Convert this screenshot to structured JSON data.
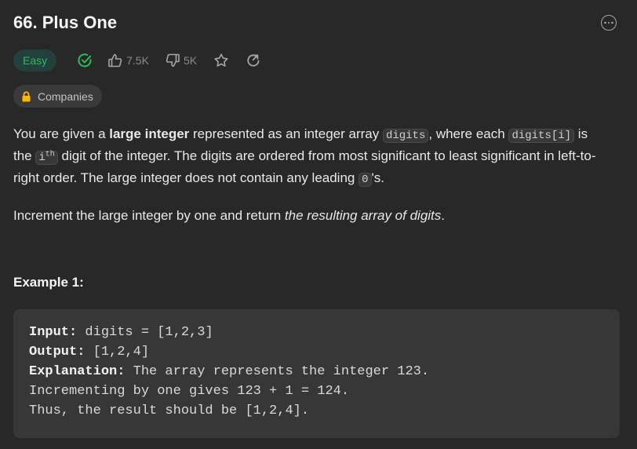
{
  "problem": {
    "title": "66. Plus One",
    "difficulty": "Easy",
    "likes": "7.5K",
    "dislikes": "5K",
    "companies_label": "Companies",
    "colors": {
      "easy": "#2cbb5d",
      "lock": "#ffb800",
      "background": "#282828"
    }
  },
  "icons": {
    "more": "more-horizontal-circle-icon",
    "solved": "check-circle-icon",
    "like": "thumbs-up-icon",
    "dislike": "thumbs-down-icon",
    "star": "star-icon",
    "share": "share-rotate-icon",
    "lock": "lock-icon"
  },
  "description": {
    "p1_a": "You are given a ",
    "p1_bold": "large integer",
    "p1_b": " represented as an integer array ",
    "code_digits": "digits",
    "p1_c": ", where each ",
    "code_digits_i": "digits[i]",
    "p1_d": " is the ",
    "code_i": "i",
    "sup_th": "th",
    "p1_e": " digit of the integer. The digits are ordered from most significant to least significant in left-to-right order. The large integer does not contain any leading ",
    "code_zero": "0",
    "p1_f": "'s.",
    "p2_a": "Increment the large integer by one and return ",
    "p2_em": "the resulting array of digits",
    "p2_b": "."
  },
  "example1": {
    "title": "Example 1:",
    "input_label": "Input:",
    "input_value": " digits = [1,2,3]",
    "output_label": "Output:",
    "output_value": " [1,2,4]",
    "explanation_label": "Explanation:",
    "explanation_value": " The array represents the integer 123.",
    "line4": "Incrementing by one gives 123 + 1 = 124.",
    "line5": "Thus, the result should be [1,2,4]."
  }
}
